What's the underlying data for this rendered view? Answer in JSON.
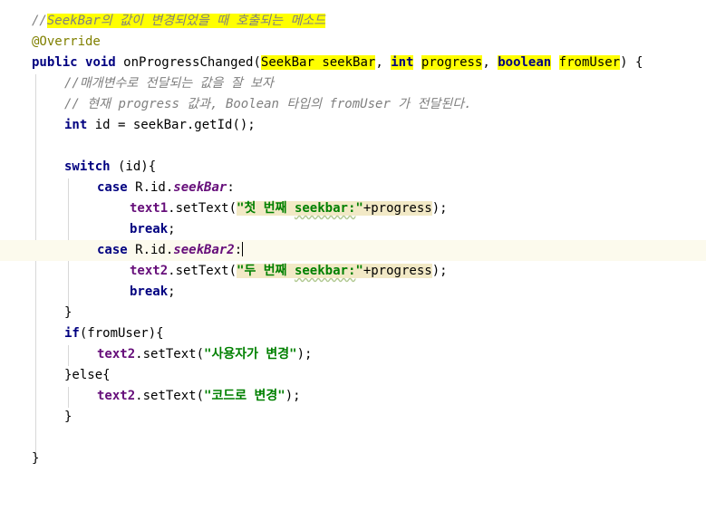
{
  "lines": [
    [
      "//",
      "SeekBar의 값이 변경되었을 때 호출되는 메소드"
    ],
    [
      "@Override"
    ],
    [
      "public",
      " ",
      "void",
      " onProgressChanged",
      "(",
      "SeekBar seekBar",
      ", ",
      "int",
      " ",
      "progress",
      ", ",
      "boolean",
      " ",
      "fromUser",
      ") {"
    ],
    [
      "//매개변수로 전달되는 값을 잘 보자"
    ],
    [
      "// 현재 progress 값과, Boolean 타입의 fromUser 가 전달된다."
    ],
    [
      "int",
      " id = seekBar.getId();"
    ],
    [
      ""
    ],
    [
      "switch",
      " (id){"
    ],
    [
      "case",
      " R.id.",
      "seekBar",
      ":"
    ],
    [
      "text1",
      ".setText(",
      "\"첫 번째 ",
      "seekbar:",
      "\"",
      "+progress",
      ");"
    ],
    [
      "break",
      ";"
    ],
    [
      "case",
      " R.id.",
      "seekBar2",
      ":"
    ],
    [
      "text2",
      ".setText(",
      "\"두 번째 ",
      "seekbar:",
      "\"",
      "+progress",
      ");"
    ],
    [
      "break",
      ";"
    ],
    [
      "}"
    ],
    [
      "if",
      "(fromUser){"
    ],
    [
      "text2",
      ".setText(",
      "\"사용자가 변경\"",
      ");"
    ],
    [
      "}else{"
    ],
    [
      "text2",
      ".setText(",
      "\"코드로 변경\"",
      ");"
    ],
    [
      "}"
    ],
    [
      ""
    ],
    [
      "}"
    ]
  ],
  "colors": {
    "keyword": "#000080",
    "comment": "#808080",
    "annotation": "#808000",
    "string": "#008000",
    "field": "#660e7a",
    "marker_highlight": "#ffff00",
    "usage_highlight": "#f2e9c6",
    "current_line": "#fcfaed"
  }
}
